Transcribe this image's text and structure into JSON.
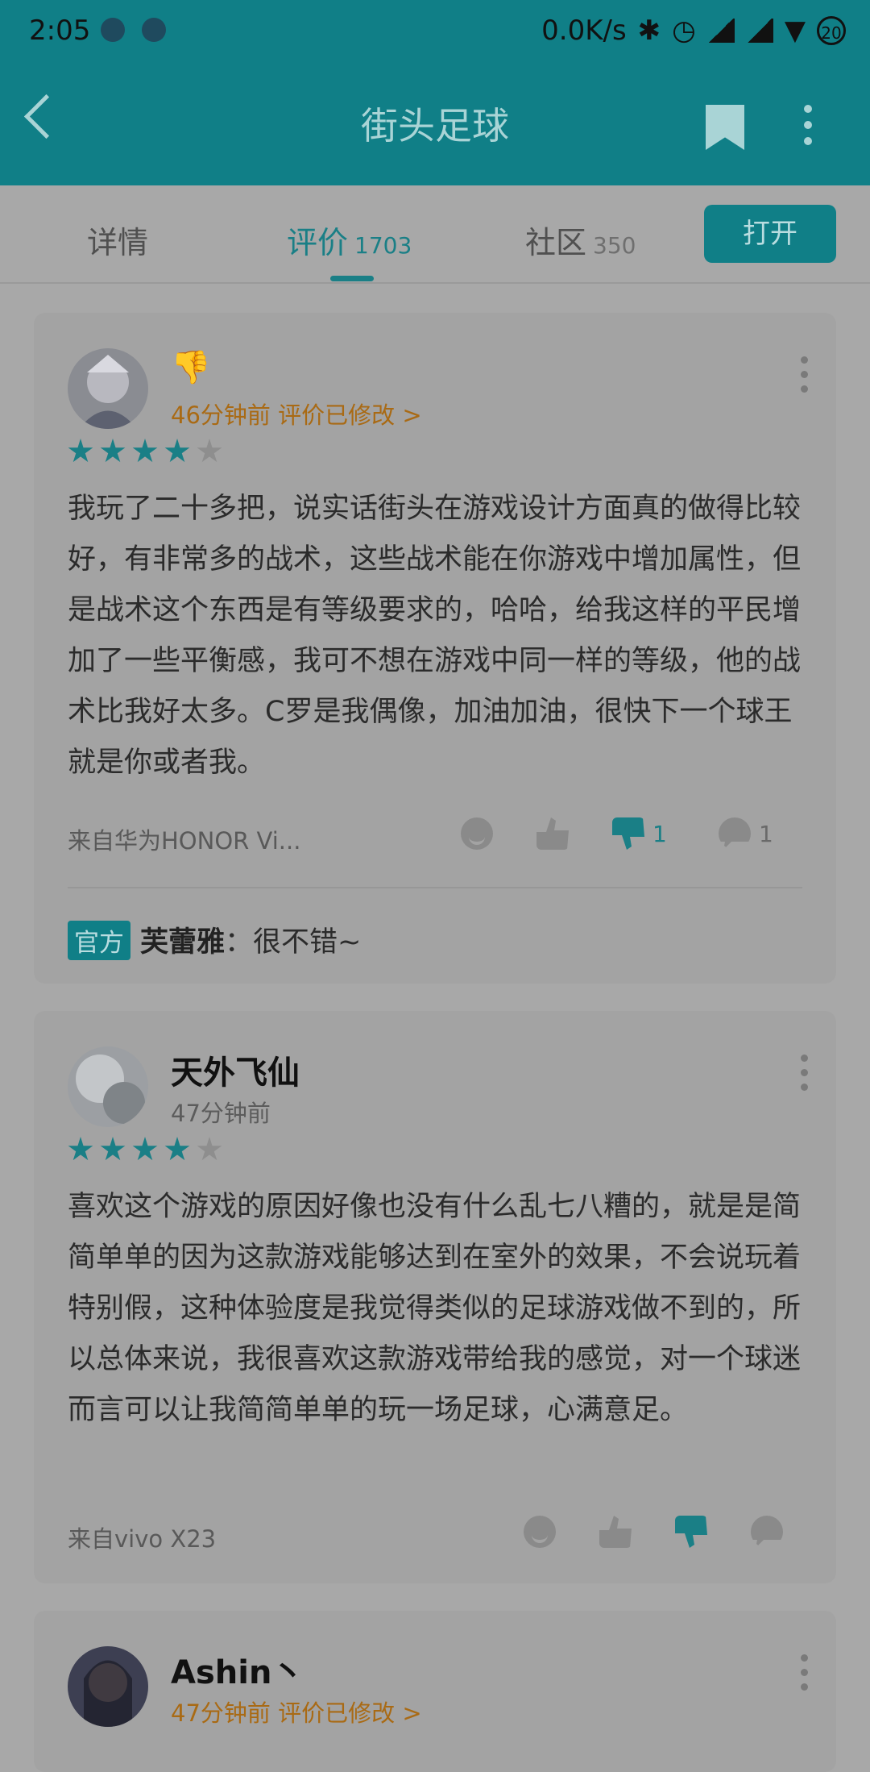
{
  "status_bar": {
    "time": "2:05",
    "network_speed": "0.0K/s",
    "battery": "20"
  },
  "app_bar": {
    "title": "街头足球",
    "icons": [
      "back-arrow-icon",
      "bookmark-icon",
      "more-vert-icon"
    ]
  },
  "tabs": [
    {
      "label": "详情",
      "count": ""
    },
    {
      "label": "评价",
      "count": "1703",
      "active": true
    },
    {
      "label": "社区",
      "count": "350"
    }
  ],
  "open_button": "打开",
  "reviews": [
    {
      "name": "",
      "emoji": "👎",
      "time": "46分钟前 评价已修改 >",
      "stars": 4,
      "text": "我玩了二十多把，说实话街头在游戏设计方面真的做得比较好，有非常多的战术，这些战术能在你游戏中增加属性，但是战术这个东西是有等级要求的，哈哈，给我这样的平民增加了一些平衡感，我可不想在游戏中同一样的等级，他的战术比我好太多。C罗是我偶像，加油加油，很快下一个球王就是你或者我。",
      "device": "来自华为HONOR Vi...",
      "down_count": "1",
      "comment_count": "1",
      "official_reply": {
        "badge": "官方",
        "author": "芙蕾雅",
        "text": "：很不错~"
      }
    },
    {
      "name": "天外飞仙",
      "time": "47分钟前",
      "stars": 4,
      "text": "喜欢这个游戏的原因好像也没有什么乱七八糟的，就是是简简单单的因为这款游戏能够达到在室外的效果，不会说玩着特别假，这种体验度是我觉得类似的足球游戏做不到的，所以总体来说，我很喜欢这款游戏带给我的感觉，对一个球迷而言可以让我简简单单的玩一场足球，心满意足。",
      "device": "来自vivo X23"
    },
    {
      "name": "Ashin丶",
      "time": "47分钟前 评价已修改 >"
    }
  ],
  "colors": {
    "accent": "#107f87",
    "orange": "#a96a14"
  }
}
